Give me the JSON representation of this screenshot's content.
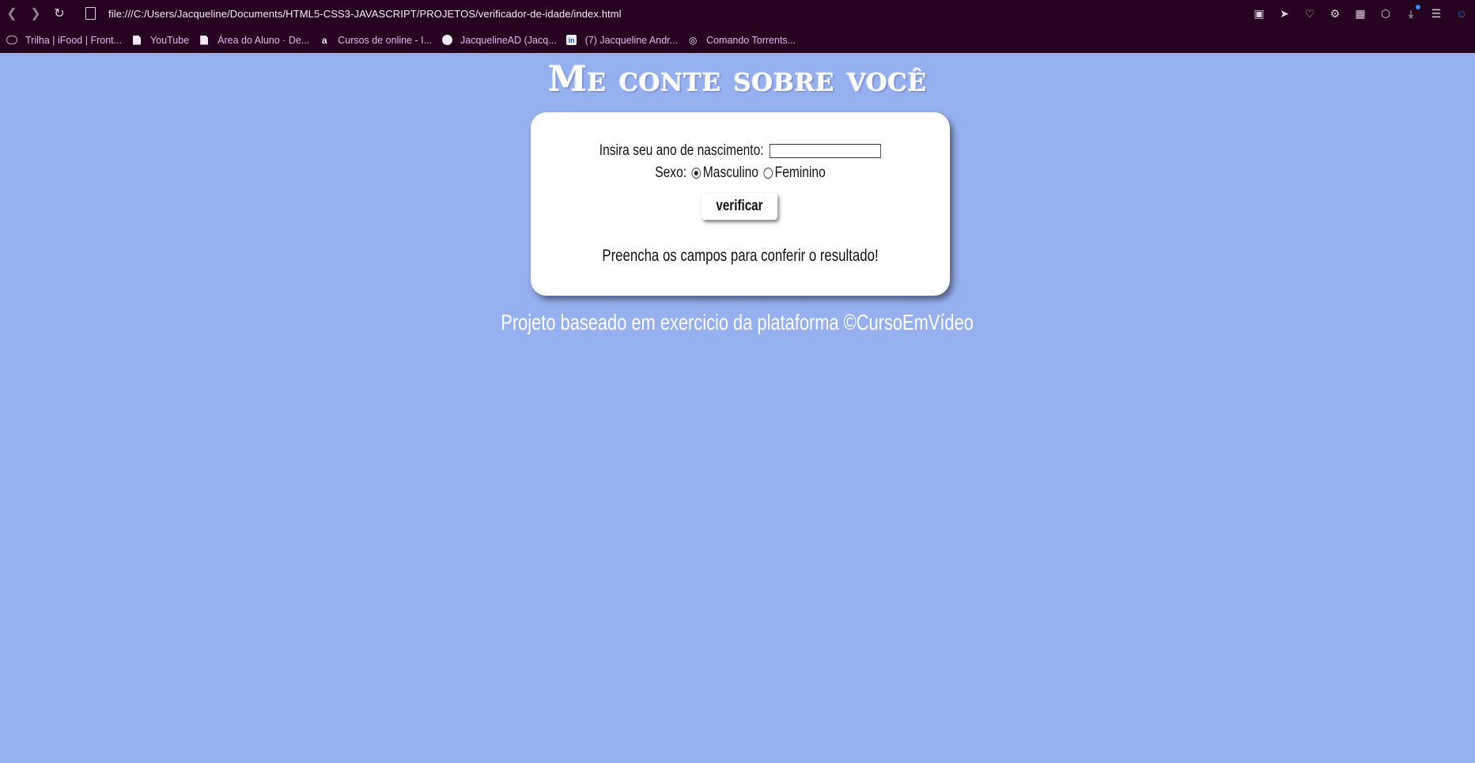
{
  "browser": {
    "url": "file:///C:/Users/Jacqueline/Documents/HTML5-CSS3-JAVASCRIPT/PROJETOS/verificador-de-idade/index.html",
    "bookmarks": [
      {
        "label": "Trilha | iFood | Front...",
        "icon": "cloud-icon"
      },
      {
        "label": "YouTube",
        "icon": "file-icon"
      },
      {
        "label": "Área do Aluno · De...",
        "icon": "file-icon"
      },
      {
        "label": "Cursos de online - I...",
        "icon": "alura-icon"
      },
      {
        "label": "JacquelineAD (Jacq...",
        "icon": "github-icon"
      },
      {
        "label": "(7) Jacqueline Andr...",
        "icon": "linkedin-icon"
      },
      {
        "label": "Comando Torrents...",
        "icon": "torrent-icon"
      }
    ]
  },
  "page": {
    "title": "Me conte sobre você",
    "form": {
      "year_label": "Insira seu ano de nascimento:",
      "year_value": "",
      "sex_label": "Sexo:",
      "option_male": "Masculino",
      "option_female": "Feminino",
      "selected": "Masculino",
      "button_label": "verificar"
    },
    "result": "Preencha os campos para conferir o resultado!",
    "footer": "Projeto baseado em exercicio da plataforma ©CursoEmVídeo"
  },
  "colors": {
    "background": "#95b0ef",
    "browser_chrome": "#260420",
    "bookmark_text": "#eab5f0"
  }
}
